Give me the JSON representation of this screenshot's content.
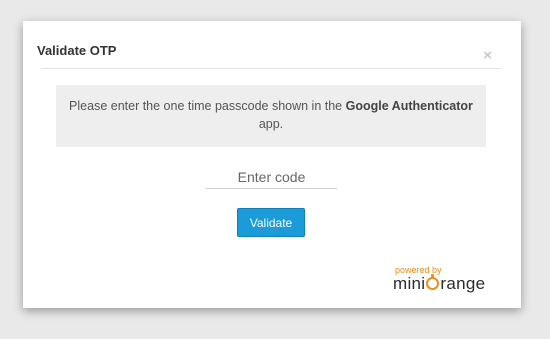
{
  "modal": {
    "title": "Validate OTP",
    "close_symbol": "×"
  },
  "message": {
    "prefix": "Please enter the one time passcode shown in the ",
    "bold": "Google Authenticator",
    "suffix": " app."
  },
  "otp_input": {
    "placeholder": "Enter code",
    "value": ""
  },
  "validate_button": {
    "label": "Validate"
  },
  "branding": {
    "powered_by": "powered by",
    "logo_text_before": "mini",
    "logo_text_after": "range",
    "logo_icon": "power-o-icon"
  },
  "colors": {
    "button": "#1b9bd7",
    "brand_orange": "#f28c1a",
    "message_bg": "#eeeeee"
  }
}
